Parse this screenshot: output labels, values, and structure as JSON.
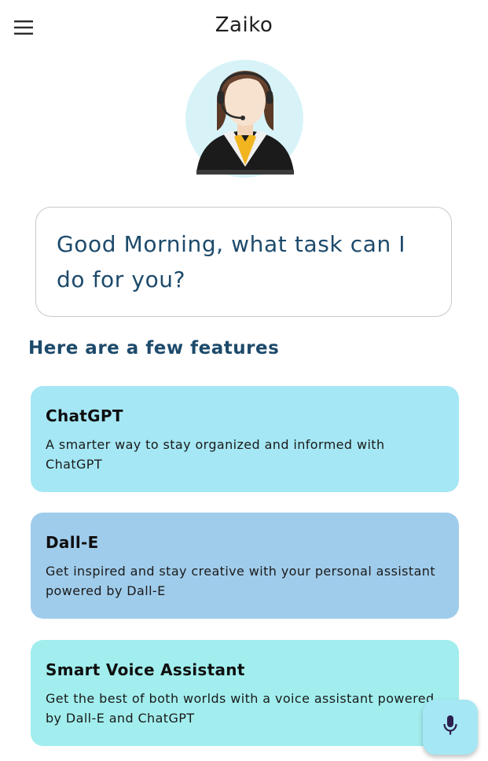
{
  "app": {
    "title": "Zaiko",
    "menu_icon": "menu-icon"
  },
  "assistant": {
    "avatar_icon": "assistant-avatar-icon",
    "greeting": "Good Morning, what task can I do for you?"
  },
  "features": {
    "heading": "Here are a few features",
    "items": [
      {
        "title": "ChatGPT",
        "description": "A smarter way to stay organized and informed with ChatGPT",
        "color": "#a5e7f4"
      },
      {
        "title": "Dall-E",
        "description": "Get inspired and stay creative with your personal assistant powered by Dall-E",
        "color": "#a0cceb"
      },
      {
        "title": "Smart Voice Assistant",
        "description": "Get the best of both worlds with a voice assistant powered by Dall-E and ChatGPT",
        "color": "#a2eeee"
      }
    ]
  },
  "fab": {
    "icon": "mic-icon",
    "color": "#a5e7f4"
  },
  "colors": {
    "accent_text": "#1d4a6b",
    "background": "#ffffff"
  }
}
